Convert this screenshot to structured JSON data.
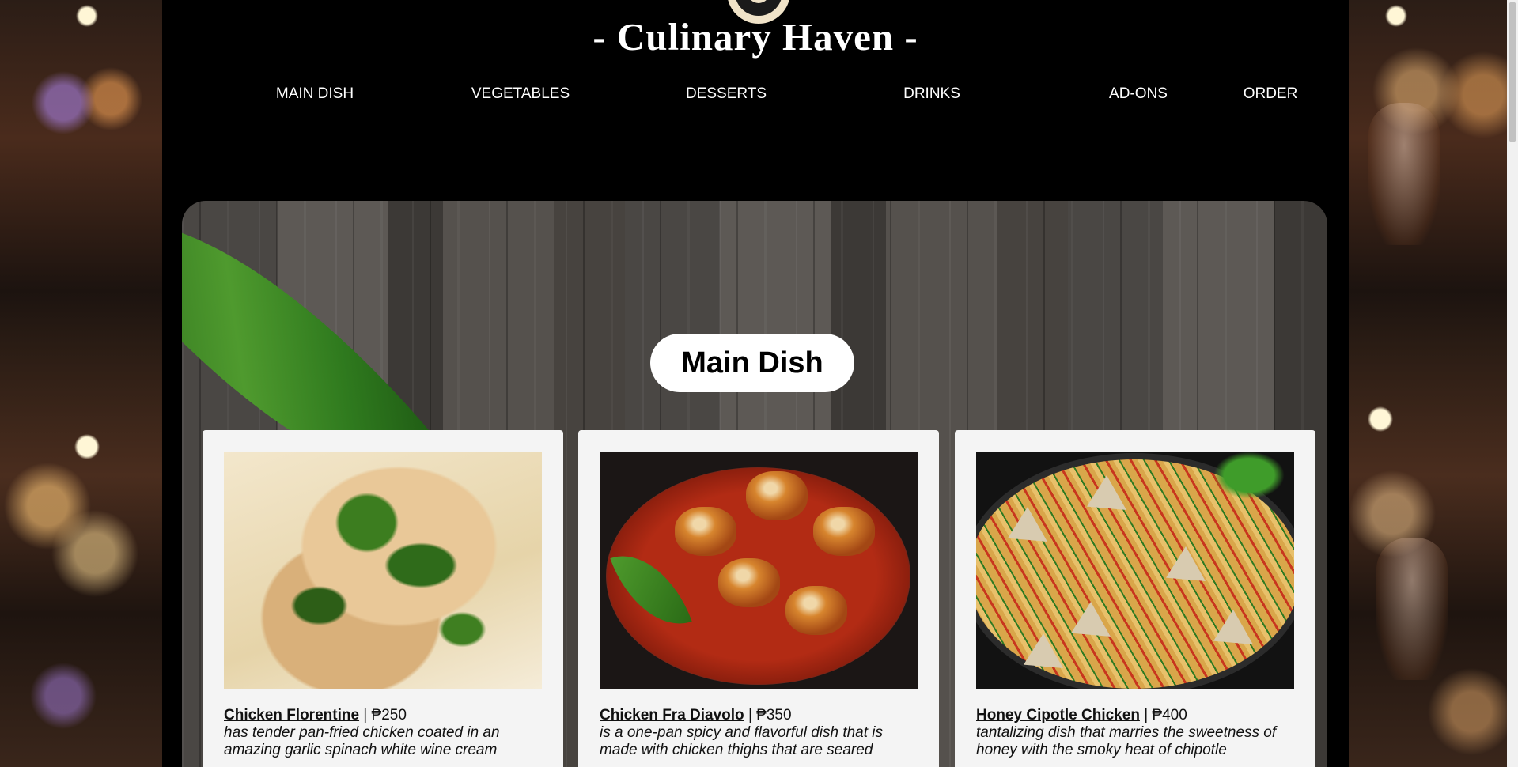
{
  "site": {
    "title": "- Culinary Haven -"
  },
  "nav": {
    "items": [
      {
        "label": "MAIN DISH"
      },
      {
        "label": "VEGETABLES"
      },
      {
        "label": "DESSERTS"
      },
      {
        "label": "DRINKS"
      },
      {
        "label": "AD-ONS"
      },
      {
        "label": "ORDER"
      }
    ]
  },
  "section": {
    "title": "Main Dish"
  },
  "dishes": [
    {
      "name": "Chicken Florentine",
      "price": "₱250",
      "description": "has tender pan-fried chicken coated in an amazing garlic spinach white wine cream"
    },
    {
      "name": "Chicken Fra Diavolo",
      "price": "₱350",
      "description": "is a one-pan spicy and flavorful dish that is made with chicken thighs that are seared"
    },
    {
      "name": "Honey Cipotle Chicken",
      "price": "₱400",
      "description": "tantalizing dish that marries the sweetness of honey with the smoky heat of chipotle"
    }
  ],
  "separator": " | ",
  "colors": {
    "page_background": "#000000",
    "title_text": "#ffffff",
    "card_background": "#f4f4f4",
    "pill_background": "#ffffff"
  }
}
